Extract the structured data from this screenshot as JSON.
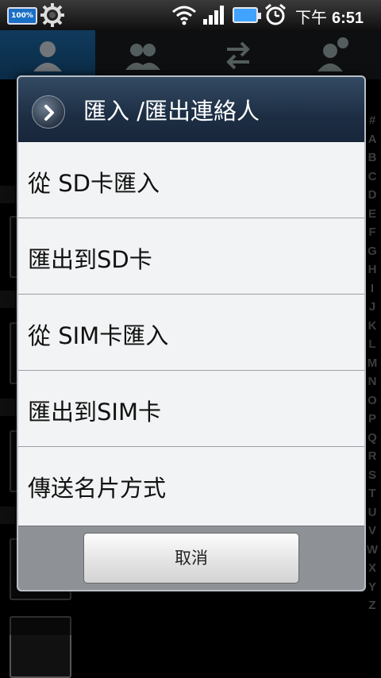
{
  "status_bar": {
    "battery_left_label": "100%",
    "time_prefix": "下午",
    "time": "6:51"
  },
  "background": {
    "index_letters": [
      "#",
      "A",
      "B",
      "C",
      "D",
      "E",
      "F",
      "G",
      "H",
      "I",
      "J",
      "K",
      "L",
      "M",
      "N",
      "O",
      "P",
      "Q",
      "R",
      "S",
      "T",
      "U",
      "V",
      "W",
      "X",
      "Y",
      "Z"
    ]
  },
  "dialog": {
    "title": "匯入 /匯出連絡人",
    "items": [
      {
        "label": "從 SD卡匯入"
      },
      {
        "label": "匯出到SD卡"
      },
      {
        "label": "從 SIM卡匯入"
      },
      {
        "label": "匯出到SIM卡"
      },
      {
        "label": "傳送名片方式"
      }
    ],
    "cancel_label": "取消"
  },
  "colors": {
    "header_bg": "#1d2e44",
    "dialog_bg": "#f2f3f4",
    "footer_bg": "#8e9297",
    "active_tab": "#1e6aa8"
  }
}
